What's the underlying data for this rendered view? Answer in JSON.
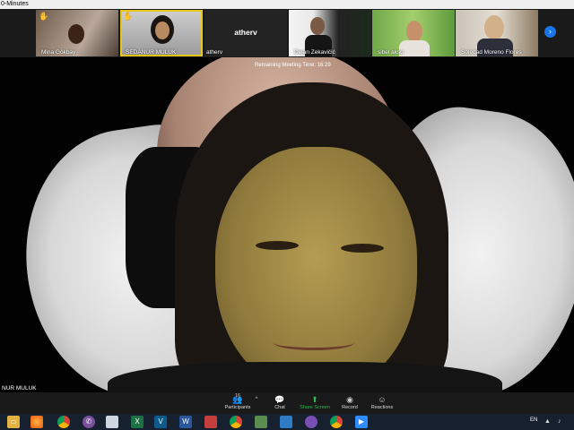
{
  "window": {
    "title": "0-Minutes"
  },
  "gallery": [
    {
      "name": "Mina Gökbay",
      "raised_hand": true,
      "active": false
    },
    {
      "name": "SEDANUR MULUK",
      "raised_hand": true,
      "active": true
    },
    {
      "name": "atherv",
      "display_name": "atherv",
      "raised_hand": false,
      "active": false
    },
    {
      "name": "Dejan Zekavičić",
      "raised_hand": false,
      "active": false
    },
    {
      "name": "sibel aksu",
      "raised_hand": false,
      "active": false
    },
    {
      "name": "Soledad Moreno Flores",
      "raised_hand": false,
      "active": false
    }
  ],
  "main_video": {
    "timer": "Remaining Meeting Time: 16:29",
    "speaker_name": "NUR MULUK"
  },
  "controls": {
    "participants_count": "16",
    "participants": "Participants",
    "chat": "Chat",
    "share_screen": "Share Screen",
    "record": "Record",
    "reactions": "Reactions"
  },
  "taskbar": {
    "language": "EN",
    "apps": [
      "folder",
      "firefox",
      "chrome",
      "viber",
      "file",
      "excel",
      "vector",
      "word",
      "app",
      "chrome2",
      "app2",
      "photo",
      "app3",
      "chrome3",
      "zoom"
    ]
  },
  "colors": {
    "accent": "#1a73e8",
    "active_border": "#e6c619",
    "share_green": "#2dbb4e"
  }
}
